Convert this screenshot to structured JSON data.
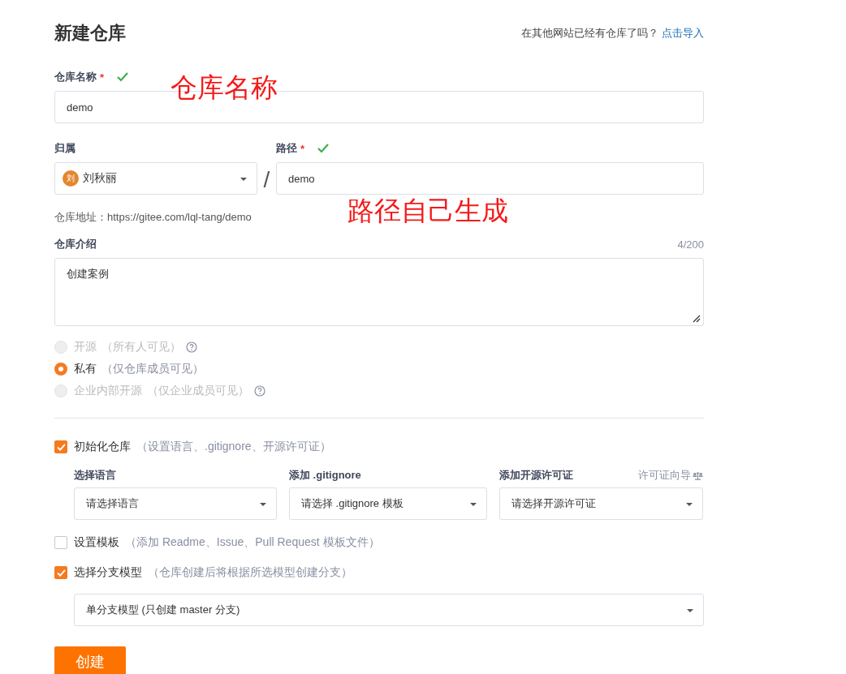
{
  "header": {
    "title": "新建仓库",
    "import_prompt": "在其他网站已经有仓库了吗？",
    "import_link": "点击导入"
  },
  "name_field": {
    "label": "仓库名称",
    "required_mark": "*",
    "valid": true,
    "value": "demo"
  },
  "owner": {
    "label": "归属",
    "avatar": "刘",
    "value": "刘秋丽"
  },
  "separator": "/",
  "path_field": {
    "label": "路径",
    "required_mark": "*",
    "valid": true,
    "value": "demo"
  },
  "repo_address": "仓库地址：https://gitee.com/lql-tang/demo",
  "description": {
    "label": "仓库介绍",
    "counter": "4/200",
    "value": "创建案例"
  },
  "visibility": [
    {
      "label": "开源",
      "note": "（所有人可见）",
      "selected": false,
      "disabled": true,
      "help": true
    },
    {
      "label": "私有",
      "note": "（仅仓库成员可见）",
      "selected": true,
      "disabled": false,
      "help": false
    },
    {
      "label": "企业内部开源",
      "note": "（仅企业成员可见）",
      "selected": false,
      "disabled": true,
      "help": true
    }
  ],
  "init": {
    "checked": true,
    "label": "初始化仓库",
    "note": "（设置语言、.gitignore、开源许可证）"
  },
  "init_selects": [
    {
      "label": "选择语言",
      "placeholder": "请选择语言"
    },
    {
      "label": "添加 .gitignore",
      "placeholder": "请选择 .gitignore 模板"
    },
    {
      "label": "添加开源许可证",
      "placeholder": "请选择开源许可证",
      "guide": "许可证向导"
    }
  ],
  "template": {
    "checked": false,
    "label": "设置模板",
    "note": "（添加 Readme、Issue、Pull Request 模板文件）"
  },
  "branch": {
    "checked": true,
    "label": "选择分支模型",
    "note": "（仓库创建后将根据所选模型创建分支）",
    "value": "单分支模型 (只创建 master 分支)"
  },
  "submit": "创建",
  "annotations": [
    {
      "text": "仓库名称"
    },
    {
      "text": "路径自己生成"
    }
  ]
}
